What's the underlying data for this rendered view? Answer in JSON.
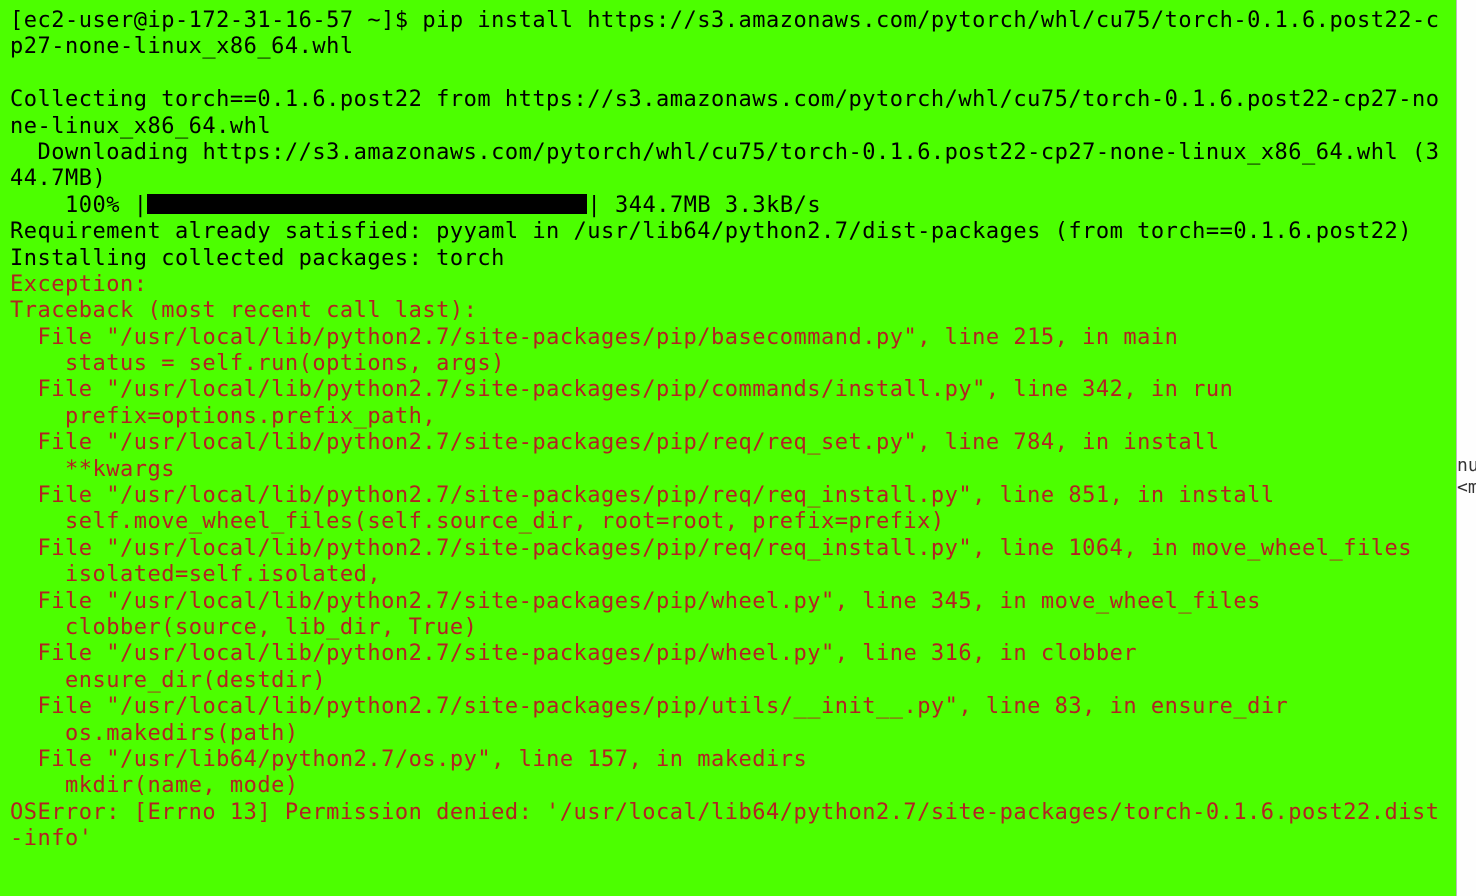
{
  "prompt": "[ec2-user@ip-172-31-16-57 ~]$ ",
  "command": "pip install https://s3.amazonaws.com/pytorch/whl/cu75/torch-0.1.6.post22-cp27-none-linux_x86_64.whl",
  "blank1": "",
  "collecting": "Collecting torch==0.1.6.post22 from https://s3.amazonaws.com/pytorch/whl/cu75/torch-0.1.6.post22-cp27-none-linux_x86_64.whl",
  "downloading": "  Downloading https://s3.amazonaws.com/pytorch/whl/cu75/torch-0.1.6.post22-cp27-none-linux_x86_64.whl (344.7MB)",
  "progress_prefix": "    100% |",
  "progress_suffix": "| 344.7MB 3.3kB/s ",
  "req_satisfied": "Requirement already satisfied: pyyaml in /usr/lib64/python2.7/dist-packages (from torch==0.1.6.post22)",
  "installing": "Installing collected packages: torch",
  "exception": "Exception:",
  "traceback_header": "Traceback (most recent call last):",
  "tb": [
    "  File \"/usr/local/lib/python2.7/site-packages/pip/basecommand.py\", line 215, in main",
    "    status = self.run(options, args)",
    "  File \"/usr/local/lib/python2.7/site-packages/pip/commands/install.py\", line 342, in run",
    "    prefix=options.prefix_path,",
    "  File \"/usr/local/lib/python2.7/site-packages/pip/req/req_set.py\", line 784, in install",
    "    **kwargs",
    "  File \"/usr/local/lib/python2.7/site-packages/pip/req/req_install.py\", line 851, in install",
    "    self.move_wheel_files(self.source_dir, root=root, prefix=prefix)",
    "  File \"/usr/local/lib/python2.7/site-packages/pip/req/req_install.py\", line 1064, in move_wheel_files",
    "    isolated=self.isolated,",
    "  File \"/usr/local/lib/python2.7/site-packages/pip/wheel.py\", line 345, in move_wheel_files",
    "    clobber(source, lib_dir, True)",
    "  File \"/usr/local/lib/python2.7/site-packages/pip/wheel.py\", line 316, in clobber",
    "    ensure_dir(destdir)",
    "  File \"/usr/local/lib/python2.7/site-packages/pip/utils/__init__.py\", line 83, in ensure_dir",
    "    os.makedirs(path)",
    "  File \"/usr/lib64/python2.7/os.py\", line 157, in makedirs",
    "    mkdir(name, mode)"
  ],
  "oserror": "OSError: [Errno 13] Permission denied: '/usr/local/lib64/python2.7/site-packages/torch-0.1.6.post22.dist-info'",
  "side_text": [
    "nu",
    "",
    "",
    "",
    "",
    "<m"
  ]
}
